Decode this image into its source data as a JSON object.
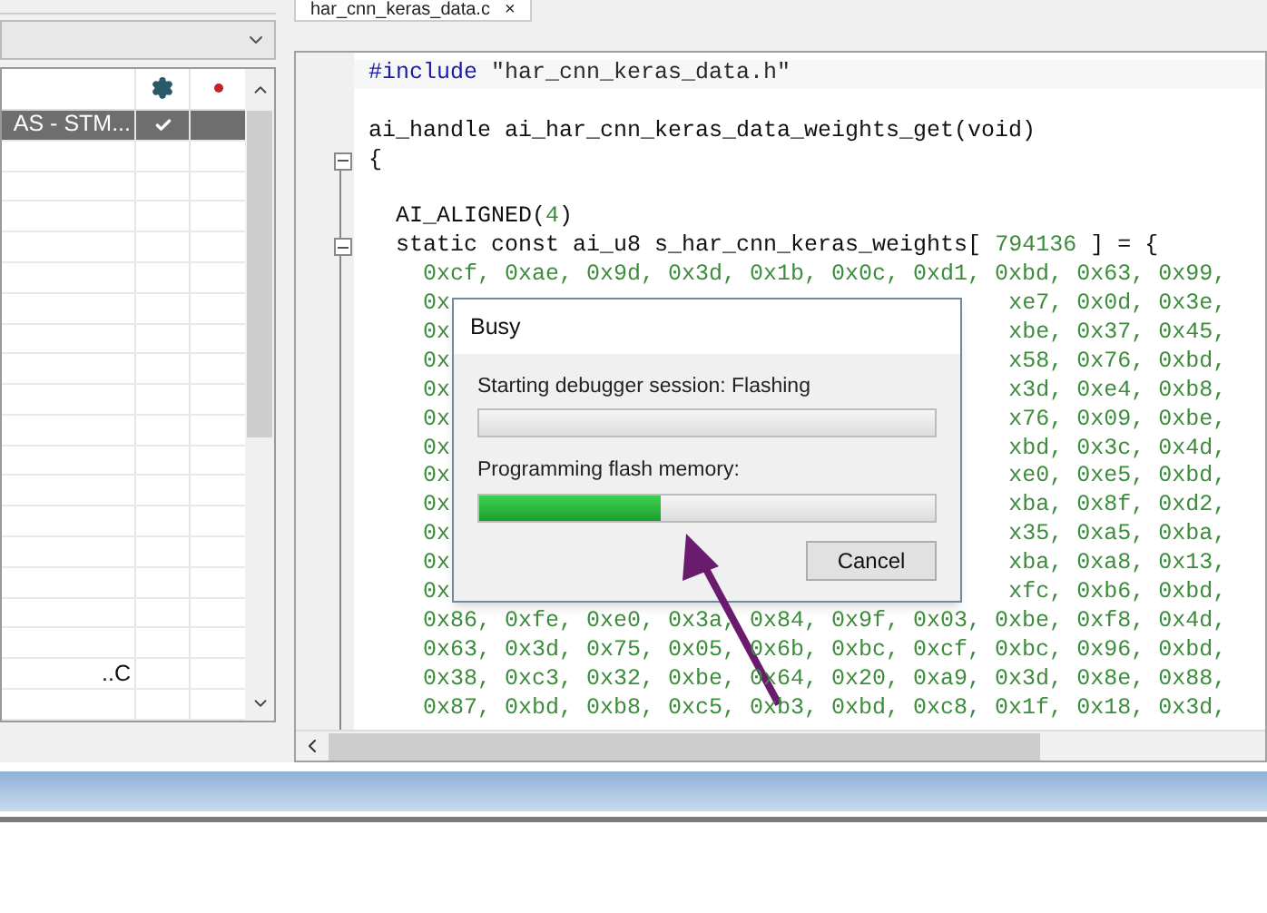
{
  "left_panel": {
    "rows": [
      {
        "name": "AS - STM...",
        "checked": true,
        "selected": true
      },
      {
        "selected": false
      },
      {
        "selected": false
      },
      {
        "selected": false
      },
      {
        "selected": false
      },
      {
        "selected": false
      },
      {
        "selected": false
      },
      {
        "selected": false
      },
      {
        "selected": false
      },
      {
        "selected": false
      },
      {
        "selected": false
      },
      {
        "selected": false
      },
      {
        "selected": false
      },
      {
        "selected": false
      },
      {
        "selected": false
      },
      {
        "selected": false
      },
      {
        "selected": false
      },
      {
        "selected": false
      },
      {
        "name": "..C",
        "selected": false
      },
      {
        "selected": false
      }
    ]
  },
  "editor": {
    "tab": {
      "label": "har_cnn_keras_data.c",
      "close": "×"
    },
    "lines": [
      {
        "fold": false,
        "segments": [
          {
            "kind": "directive",
            "text": "#include"
          },
          {
            "kind": "string",
            "text": " \"har_cnn_keras_data.h\""
          }
        ]
      },
      {
        "fold": false
      },
      {
        "fold": false,
        "segments": [
          {
            "kind": "plain",
            "text": "ai_handle ai_har_cnn_keras_data_weights_get(void)"
          }
        ]
      },
      {
        "fold": true,
        "segments": [
          {
            "kind": "plain",
            "text": "{"
          }
        ]
      },
      {
        "fold": false
      },
      {
        "fold": false,
        "segments": [
          {
            "kind": "plain",
            "text": "  AI_ALIGNED("
          },
          {
            "kind": "number",
            "text": "4"
          },
          {
            "kind": "plain",
            "text": ")"
          }
        ]
      },
      {
        "fold": true,
        "segments": [
          {
            "kind": "plain",
            "text": "  static const ai_u8 s_har_cnn_keras_weights[ "
          },
          {
            "kind": "number",
            "text": "794136"
          },
          {
            "kind": "plain",
            "text": " ] = {"
          }
        ]
      },
      {
        "fold": false,
        "segments": [
          {
            "kind": "number",
            "text": "    0xcf, 0xae, 0x9d, 0x3d, 0x1b, 0x0c, 0xd1, 0xbd, 0x63, 0x99,"
          }
        ]
      },
      {
        "fold": false,
        "left": "    0x",
        "right": "xe7, 0x0d, 0x3e,"
      },
      {
        "fold": false,
        "left": "    0x",
        "right": "xbe, 0x37, 0x45,"
      },
      {
        "fold": false,
        "left": "    0x",
        "right": "x58, 0x76, 0xbd,"
      },
      {
        "fold": false,
        "left": "    0x",
        "right": "x3d, 0xe4, 0xb8,"
      },
      {
        "fold": false,
        "left": "    0x",
        "right": "x76, 0x09, 0xbe,"
      },
      {
        "fold": false,
        "left": "    0x",
        "right": "xbd, 0x3c, 0x4d,"
      },
      {
        "fold": false,
        "left": "    0x",
        "right": "xe0, 0xe5, 0xbd,"
      },
      {
        "fold": false,
        "left": "    0x",
        "right": "xba, 0x8f, 0xd2,"
      },
      {
        "fold": false,
        "left": "    0x",
        "right": "x35, 0xa5, 0xba,"
      },
      {
        "fold": false,
        "left": "    0x",
        "right": "xba, 0xa8, 0x13,"
      },
      {
        "fold": false,
        "left": "    0x",
        "right": "xfc, 0xb6, 0xbd,"
      },
      {
        "fold": false,
        "segments": [
          {
            "kind": "number",
            "text": "    0x86, 0xfe, 0xe0, 0x3a, 0x84, 0x9f, 0x03, 0xbe, 0xf8, 0x4d,"
          }
        ]
      },
      {
        "fold": false,
        "segments": [
          {
            "kind": "number",
            "text": "    0x63, 0x3d, 0x75, 0x05, 0x6b, 0xbc, 0xcf, 0xbc, 0x96, 0xbd,"
          }
        ]
      },
      {
        "fold": false,
        "segments": [
          {
            "kind": "number",
            "text": "    0x38, 0xc3, 0x32, 0xbe, 0x64, 0x20, 0xa9, 0x3d, 0x8e, 0x88,"
          }
        ]
      },
      {
        "fold": false,
        "segments": [
          {
            "kind": "number",
            "text": "    0x87, 0xbd, 0xb8, 0xc5, 0xb3, 0xbd, 0xc8, 0x1f, 0x18, 0x3d,"
          }
        ]
      }
    ]
  },
  "dialog": {
    "title": "Busy",
    "steps": [
      {
        "label": "Starting debugger session: Flashing",
        "level": 0
      },
      {
        "label": "Programming flash memory:",
        "level": 0.4
      }
    ],
    "buttons": [
      "Cancel"
    ]
  }
}
